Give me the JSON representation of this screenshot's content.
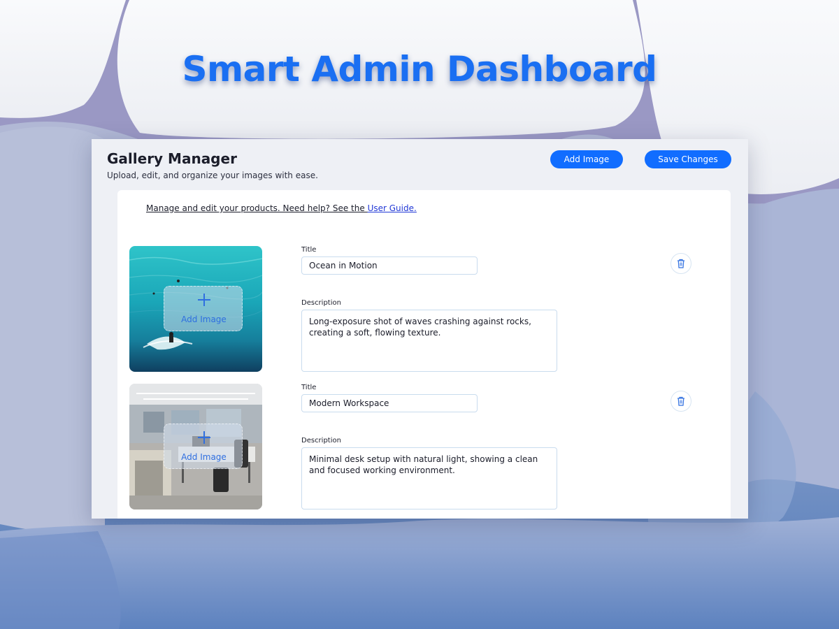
{
  "headline": "Smart Admin Dashboard",
  "app": {
    "title": "Gallery Manager",
    "subtitle": "Upload, edit, and organize your images with ease.",
    "toolbar": {
      "add_image_label": "Add Image",
      "save_changes_label": "Save Changes"
    },
    "help": {
      "text": "Manage and edit your products. Need help? See the ",
      "link_text": "User Guide."
    },
    "items": [
      {
        "image": "ocean-surfer-photo",
        "overlay_label": "Add Image",
        "title_label": "Title",
        "title_value": "Ocean in Motion",
        "description_label": "Description",
        "description_value": "Long-exposure shot of waves crashing against rocks, creating a soft, flowing texture.",
        "delete_icon": "trash-icon"
      },
      {
        "image": "office-workspace-photo",
        "overlay_label": "Add Image",
        "title_label": "Title",
        "title_value": "Modern Workspace",
        "description_label": "Description",
        "description_value": "Minimal desk setup with natural light, showing a clean and focused working environment.",
        "delete_icon": "trash-icon"
      }
    ]
  },
  "colors": {
    "accent": "#116dff",
    "headline": "#1a6ff2",
    "link": "#2138d6",
    "window_bg": "#eef0f5",
    "panel_bg": "#ffffff"
  }
}
